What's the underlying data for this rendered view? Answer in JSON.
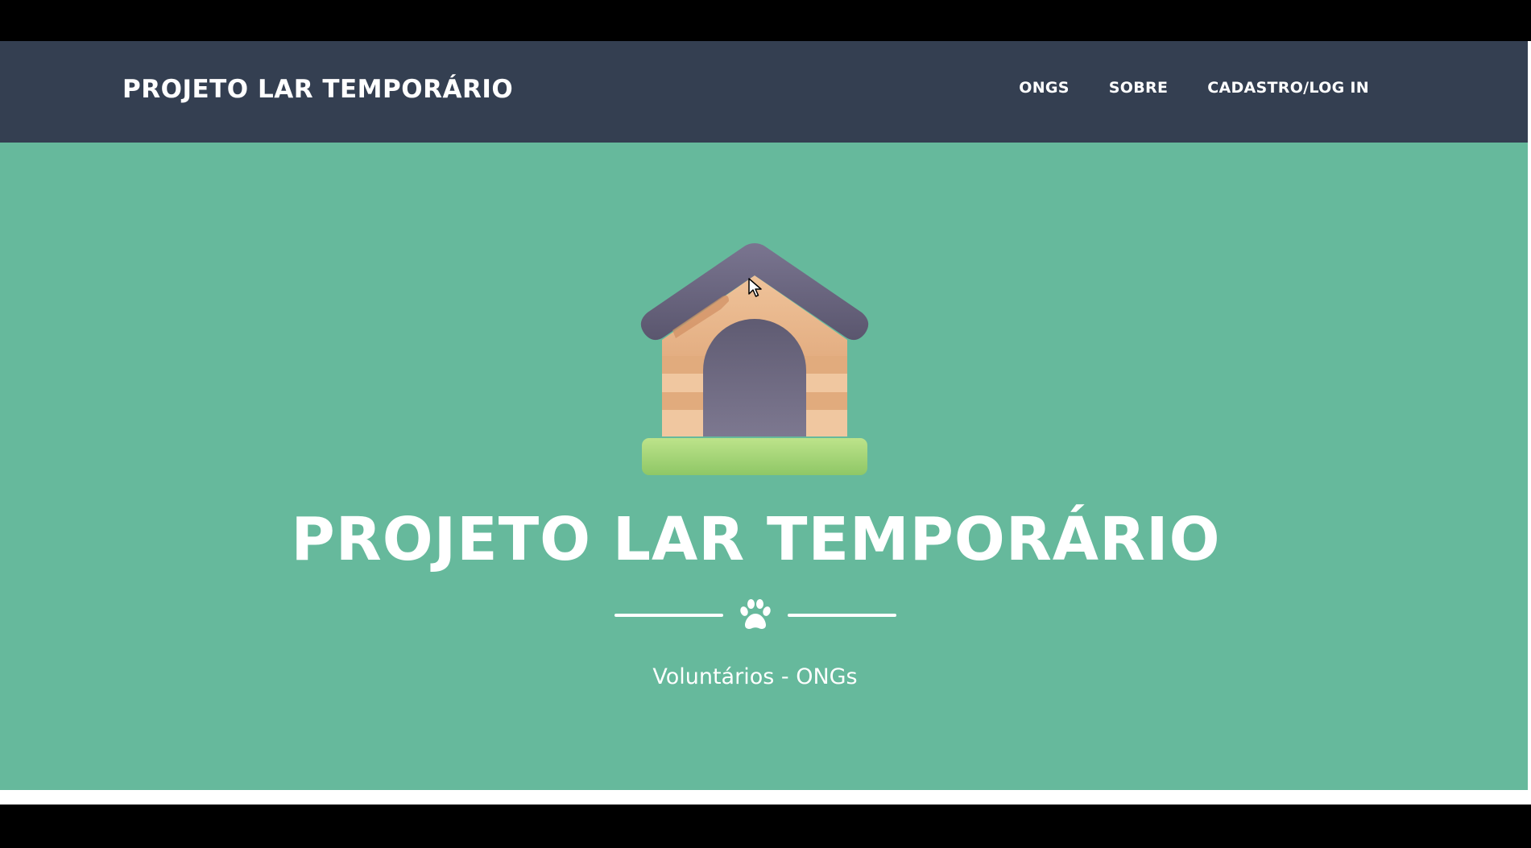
{
  "navbar": {
    "brand": "PROJETO LAR TEMPORÁRIO",
    "links": [
      "ONGS",
      "SOBRE",
      "CADASTRO/LOG IN"
    ]
  },
  "hero": {
    "title": "PROJETO LAR TEMPORÁRIO",
    "subtitle": "Voluntários - ONGs",
    "icon": "dog-house-icon",
    "divider_icon": "paw-icon"
  },
  "colors": {
    "navbar_bg": "#343f51",
    "hero_bg": "#66b99c",
    "text": "#ffffff"
  }
}
